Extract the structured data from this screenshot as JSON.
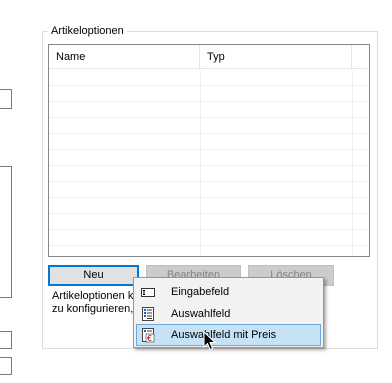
{
  "group": {
    "title": "Artikeloptionen"
  },
  "list": {
    "columns": [
      "Name",
      "Typ"
    ],
    "rows": []
  },
  "buttons": {
    "new_label": "Neu",
    "edit_label": "Bearbeiten",
    "delete_label": "Löschen"
  },
  "description": {
    "line1": "Artikeloptionen kö",
    "line2": "zu konfigurieren, z"
  },
  "context_menu": {
    "items": [
      {
        "label": "Eingabefeld",
        "icon": "input-field-icon"
      },
      {
        "label": "Auswahlfeld",
        "icon": "list-field-icon"
      },
      {
        "label": "Auswahlfeld mit Preis",
        "icon": "price-list-icon",
        "highlighted": true
      }
    ]
  },
  "colors": {
    "accent": "#0078d7",
    "menu_highlight": "#c6e2f7",
    "menu_highlight_border": "#6fa8d8"
  }
}
